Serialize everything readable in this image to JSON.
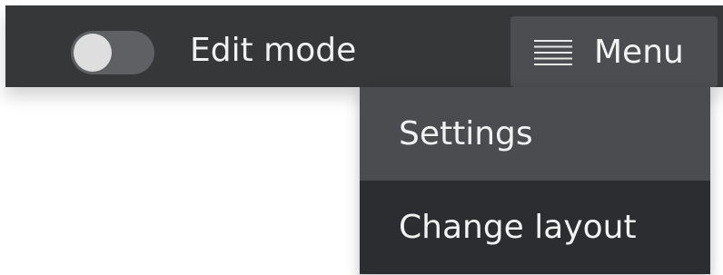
{
  "topbar": {
    "edit_mode_label": "Edit mode",
    "edit_mode_on": false,
    "menu_label": "Menu",
    "menu_icon": "hamburger-icon"
  },
  "dropdown": {
    "items": [
      {
        "label": "Settings",
        "state": "hover"
      },
      {
        "label": "Change layout"
      }
    ]
  },
  "colors": {
    "topbar_bg": "#353739",
    "menu_button_bg": "#4b4d50",
    "dropdown_hover_bg": "#4a4c4f",
    "dropdown_bg": "#2b2d30",
    "text": "#f2f2f2"
  }
}
